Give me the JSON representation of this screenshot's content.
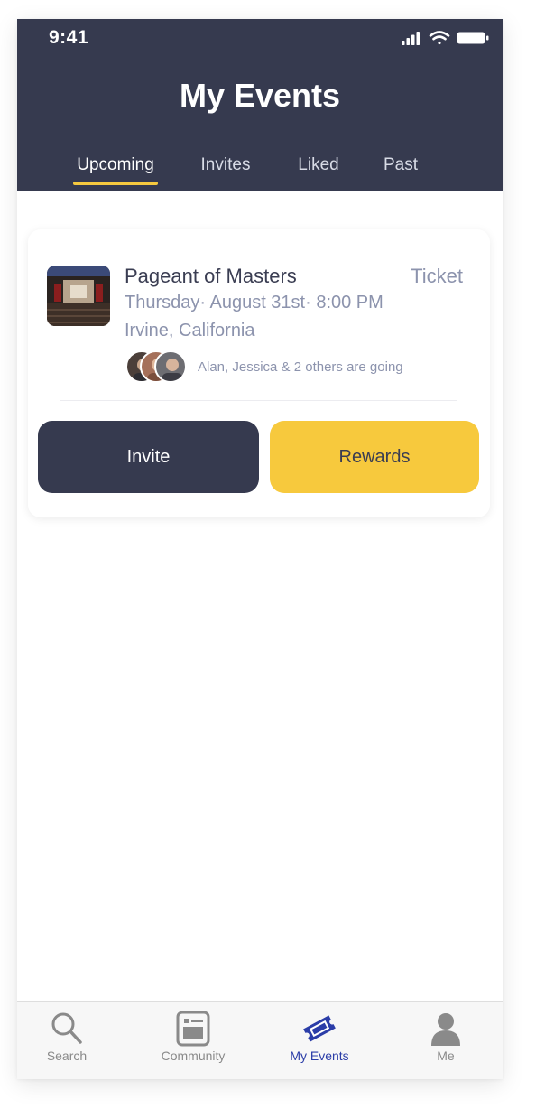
{
  "status_bar": {
    "time": "9:41"
  },
  "header": {
    "title": "My Events",
    "tabs": [
      {
        "label": "Upcoming",
        "active": true
      },
      {
        "label": "Invites",
        "active": false
      },
      {
        "label": "Liked",
        "active": false
      },
      {
        "label": "Past",
        "active": false
      }
    ]
  },
  "event_card": {
    "title": "Pageant of Masters",
    "ticket_label": "Ticket",
    "date_time": "Thursday· August 31st· 8:00 PM",
    "location": "Irvine, California",
    "attendees_text": "Alan, Jessica & 2 others are going",
    "invite_button": "Invite",
    "rewards_button": "Rewards"
  },
  "bottom_nav": {
    "items": [
      {
        "label": "Search",
        "icon": "search-icon",
        "active": false
      },
      {
        "label": "Community",
        "icon": "community-icon",
        "active": false
      },
      {
        "label": "My Events",
        "icon": "ticket-icon",
        "active": true
      },
      {
        "label": "Me",
        "icon": "person-icon",
        "active": false
      }
    ]
  },
  "colors": {
    "header_bg": "#363a4f",
    "accent_yellow": "#f7c93d",
    "active_nav": "#2b3da8",
    "muted_text": "#8c93ad"
  }
}
